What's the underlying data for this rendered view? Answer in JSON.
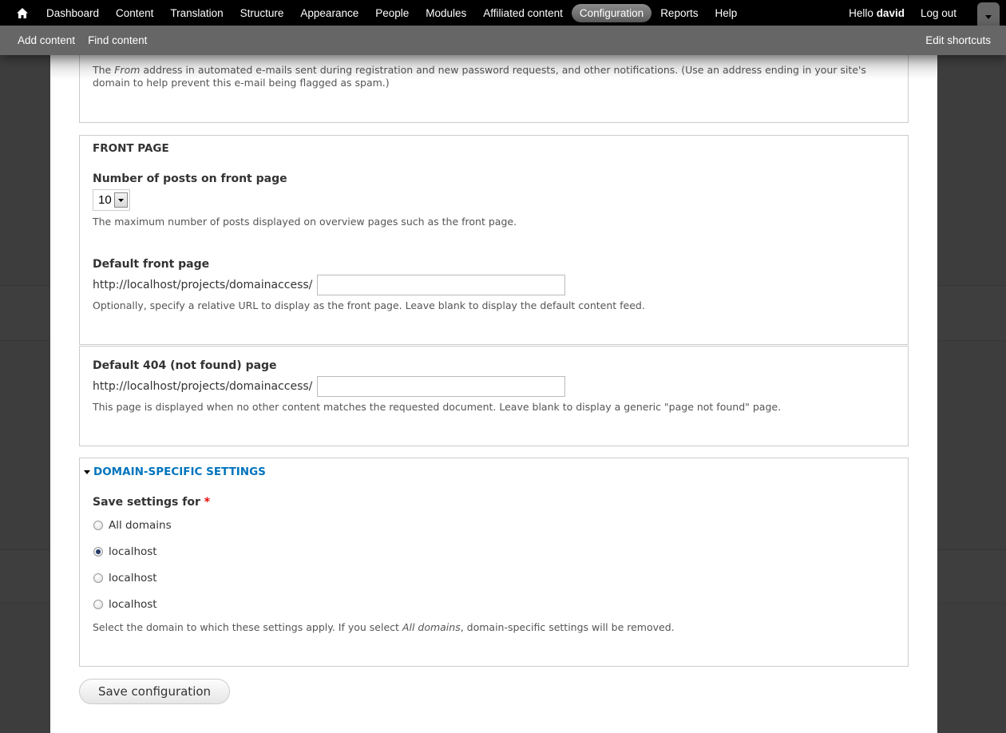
{
  "toolbar": {
    "home_icon": "home-icon",
    "menu": [
      {
        "label": "Dashboard",
        "active": false
      },
      {
        "label": "Content",
        "active": false
      },
      {
        "label": "Translation",
        "active": false
      },
      {
        "label": "Structure",
        "active": false
      },
      {
        "label": "Appearance",
        "active": false
      },
      {
        "label": "People",
        "active": false
      },
      {
        "label": "Modules",
        "active": false
      },
      {
        "label": "Affiliated content",
        "active": false
      },
      {
        "label": "Configuration",
        "active": true
      },
      {
        "label": "Reports",
        "active": false
      },
      {
        "label": "Help",
        "active": false
      }
    ],
    "greeting": "Hello ",
    "username": "david",
    "logout": "Log out",
    "toggle_icon": "chevron-down-icon"
  },
  "shortcuts": {
    "items": [
      "Add content",
      "Find content"
    ],
    "edit": "Edit shortcuts"
  },
  "email_section": {
    "description_pre": "The ",
    "description_em": "From",
    "description_post": " address in automated e-mails sent during registration and new password requests, and other notifications. (Use an address ending in your site's domain to help prevent this e-mail being flagged as spam.)"
  },
  "front_page": {
    "legend": "FRONT PAGE",
    "posts_label": "Number of posts on front page",
    "posts_value": "10",
    "posts_description": "The maximum number of posts displayed on overview pages such as the front page.",
    "default_front_label": "Default front page",
    "url_prefix": "http://localhost/projects/domainaccess/",
    "default_front_value": "",
    "default_front_description": "Optionally, specify a relative URL to display as the front page. Leave blank to display the default content feed."
  },
  "error_pages": {
    "not_found_label": "Default 404 (not found) page",
    "url_prefix": "http://localhost/projects/domainaccess/",
    "not_found_value": "",
    "not_found_description": "This page is displayed when no other content matches the requested document. Leave blank to display a generic \"page not found\" page."
  },
  "domain_settings": {
    "legend": "DOMAIN-SPECIFIC SETTINGS",
    "save_for_label": "Save settings for",
    "required_mark": "*",
    "options": [
      {
        "label": "All domains",
        "checked": false
      },
      {
        "label": "localhost",
        "checked": true
      },
      {
        "label": "localhost",
        "checked": false
      },
      {
        "label": "localhost",
        "checked": false
      }
    ],
    "description_pre": "Select the domain to which these settings apply. If you select ",
    "description_em": "All domains",
    "description_post": ", domain-specific settings will be removed."
  },
  "actions": {
    "save_label": "Save configuration"
  },
  "colors": {
    "link": "#0074bd",
    "required": "#ee0000",
    "toolbar_bg": "#000000",
    "shortcuts_bg": "#666666"
  }
}
